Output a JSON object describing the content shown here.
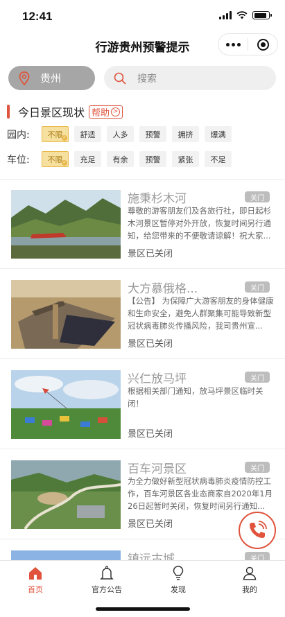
{
  "status_bar": {
    "time": "12:41"
  },
  "nav": {
    "title": "行游贵州预警提示"
  },
  "region": {
    "label": "贵州"
  },
  "search": {
    "placeholder": "搜索"
  },
  "today": {
    "title": "今日景区现状",
    "help_label": "帮助",
    "help_arrow": ">"
  },
  "filters": {
    "park": {
      "label": "园内:",
      "options": [
        "不限",
        "舒适",
        "人多",
        "预警",
        "拥挤",
        "爆满"
      ],
      "selected": "不限"
    },
    "parking": {
      "label": "车位:",
      "options": [
        "不限",
        "充足",
        "有余",
        "预警",
        "紧张",
        "不足"
      ],
      "selected": "不限"
    }
  },
  "spots": [
    {
      "name": "施秉杉木河",
      "badge": "关门",
      "desc": "尊敬的游客朋友们及各旅行社，即日起杉木河景区暂停对外开放，恢复时间另行通知，给您带来的不便敬请谅解！祝大家...",
      "status": "景区已关闭"
    },
    {
      "name": "大方慕俄格...",
      "badge": "关门",
      "desc": "【公告】 为保障广大游客朋友的身体健康和生命安全，避免人群聚集可能导致新型冠状病毒肺炎传播风险，我司贵州宣...",
      "status": "景区已关闭"
    },
    {
      "name": "兴仁放马坪",
      "badge": "关门",
      "desc": "根据相关部门通知，放马坪景区临时关闭！",
      "status": "景区已关闭"
    },
    {
      "name": "百车河景区",
      "badge": "关门",
      "desc": "为全力做好新型冠状病毒肺炎疫情防控工作，百车河景区各业态商家自2020年1月26日起暂时关闭，恢复时间另行通知...",
      "status": "景区已关闭"
    },
    {
      "name": "镇远古城",
      "badge": "关门",
      "desc": "",
      "status": ""
    }
  ],
  "tabbar": {
    "items": [
      {
        "label": "首页",
        "icon": "home-icon",
        "active": true
      },
      {
        "label": "官方公告",
        "icon": "bell-icon",
        "active": false
      },
      {
        "label": "发现",
        "icon": "bulb-icon",
        "active": false
      },
      {
        "label": "我的",
        "icon": "user-icon",
        "active": false
      }
    ]
  },
  "colors": {
    "accent": "#e0533d",
    "chip_active": "#f6e0a0",
    "badge": "#bdbdbd"
  }
}
